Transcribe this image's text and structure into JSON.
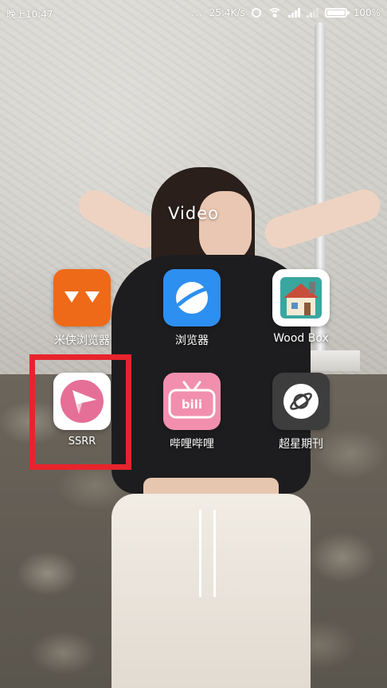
{
  "status_bar": {
    "time": "晚上10:47",
    "dots": "...",
    "network_speed": "25.4K/s",
    "battery_percent": "100%",
    "battery_level": 1.0,
    "icons": [
      "alarm-icon",
      "wifi-icon",
      "signal-icon",
      "signal-icon",
      "battery-icon"
    ]
  },
  "folder": {
    "title": "Video",
    "apps": [
      {
        "label": "米侠浏览器",
        "icon": "mixia-browser-icon",
        "color": "#ee6a18"
      },
      {
        "label": "浏览器",
        "icon": "browser-icon",
        "color": "#2d8ff0"
      },
      {
        "label": "Wood Box",
        "icon": "wood-box-icon",
        "color": "#ffffff"
      },
      {
        "label": "SSRR",
        "icon": "paper-plane-icon",
        "color": "#e56f97"
      },
      {
        "label": "哔哩哔哩",
        "icon": "bilibili-icon",
        "color": "#f28fae"
      },
      {
        "label": "超星期刊",
        "icon": "planet-icon",
        "color": "#3d3d3d"
      }
    ],
    "highlighted_app": "SSRR",
    "highlight_color": "#e7242c"
  }
}
